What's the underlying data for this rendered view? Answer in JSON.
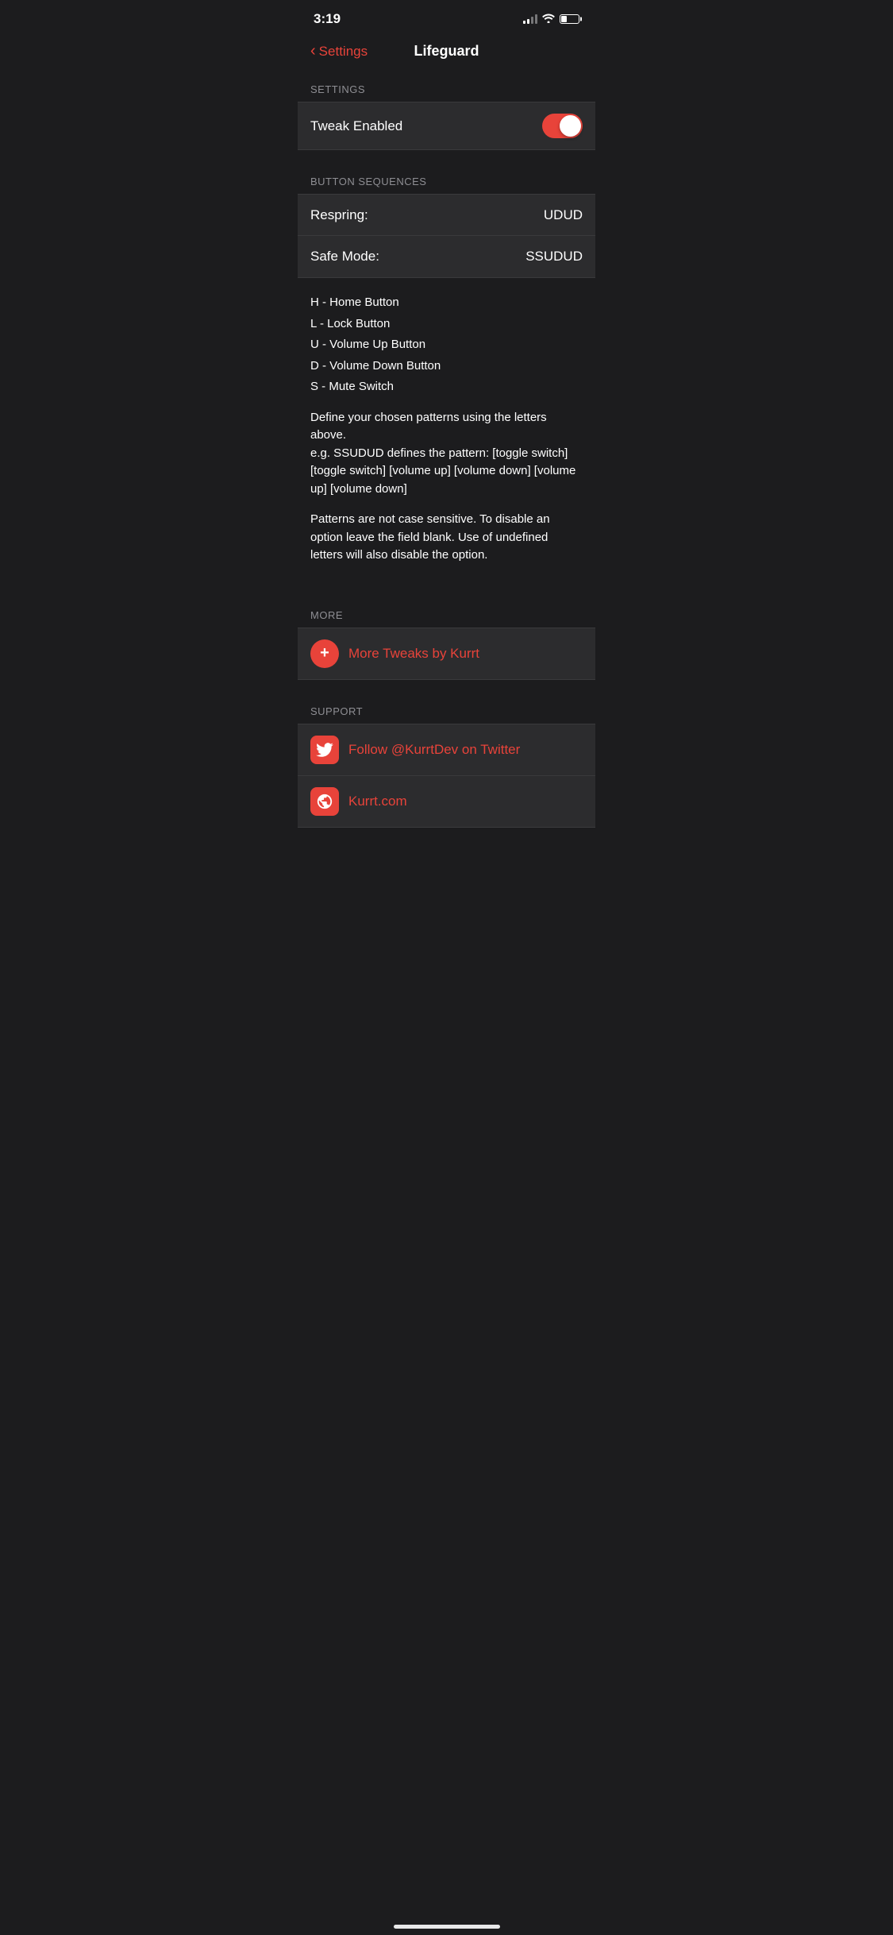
{
  "statusBar": {
    "time": "3:19",
    "signalBars": [
      2,
      4,
      6,
      8,
      10
    ],
    "batteryLevel": 35
  },
  "navBar": {
    "backLabel": "Settings",
    "title": "Lifeguard"
  },
  "sections": {
    "settings": {
      "header": "SETTINGS",
      "tweakEnabled": {
        "label": "Tweak Enabled",
        "enabled": true
      }
    },
    "buttonSequences": {
      "header": "BUTTON SEQUENCES",
      "respring": {
        "label": "Respring:",
        "value": "UDUD"
      },
      "safeMode": {
        "label": "Safe Mode:",
        "value": "SSUDUD"
      }
    },
    "description": {
      "legend": [
        "H - Home Button",
        "L - Lock Button",
        "U - Volume Up Button",
        "D - Volume Down Button",
        "S - Mute Switch"
      ],
      "para1": "Define your chosen patterns using the letters above.\ne.g. SSUDUD defines the pattern: [toggle switch] [toggle switch] [volume up] [volume down] [volume up] [volume down]",
      "para2": "Patterns are not case sensitive. To disable an option leave the field blank. Use of undefined letters will also disable the option."
    },
    "more": {
      "header": "MORE",
      "moreTweaks": {
        "label": "More Tweaks by Kurrt",
        "icon": "+"
      }
    },
    "support": {
      "header": "SUPPORT",
      "twitter": {
        "label": "Follow @KurrtDev on Twitter"
      },
      "website": {
        "label": "Kurrt.com"
      }
    }
  }
}
